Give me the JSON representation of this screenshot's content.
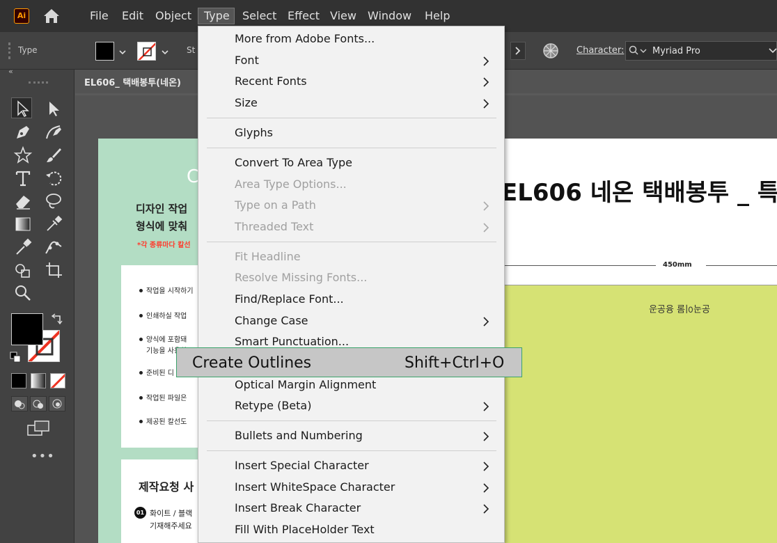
{
  "app": {
    "logo": "Ai",
    "home_icon": "home-icon"
  },
  "menubar": [
    "File",
    "Edit",
    "Object",
    "Type",
    "Select",
    "Effect",
    "View",
    "Window",
    "Help"
  ],
  "control": {
    "label": "Type",
    "stroke_label": "St",
    "character_label": "Character:",
    "font_name": "Myriad Pro"
  },
  "document": {
    "title": "EL606_ 택배봉투(네온)"
  },
  "artboard_left": {
    "big_letter": "C",
    "heading1": "디자인 작업",
    "heading2": "형식에 맞춰",
    "warning": "*각 종류마다 칼선",
    "bullets": [
      "작업을 시작하기",
      "인쇄하실 작업",
      "양식에 포함돼",
      "기능을 사용하",
      "준비된 디",
      "작업된 파일은",
      "제공된 칼선도"
    ],
    "box2_title": "제작요청 사",
    "box2_num": "01",
    "box2_line1": "화이트 / 블랙",
    "box2_line2": "기재해주세요"
  },
  "artboard_right": {
    "title": "EL606 네온 택배봉투 _ 특",
    "dimension": "450mm",
    "bag_text": "운곡이물 용운공"
  },
  "type_menu": {
    "items": [
      {
        "label": "More from Adobe Fonts...",
        "enabled": true,
        "submenu": false
      },
      {
        "label": "Font",
        "enabled": true,
        "submenu": true
      },
      {
        "label": "Recent Fonts",
        "enabled": true,
        "submenu": true
      },
      {
        "label": "Size",
        "enabled": true,
        "submenu": true
      },
      {
        "label": "Glyphs",
        "enabled": true,
        "submenu": false
      },
      {
        "label": "Convert To Area Type",
        "enabled": true,
        "submenu": false
      },
      {
        "label": "Area Type Options...",
        "enabled": false,
        "submenu": false
      },
      {
        "label": "Type on a Path",
        "enabled": false,
        "submenu": true
      },
      {
        "label": "Threaded Text",
        "enabled": false,
        "submenu": true
      },
      {
        "label": "Fit Headline",
        "enabled": false,
        "submenu": false
      },
      {
        "label": "Resolve Missing Fonts...",
        "enabled": false,
        "submenu": false
      },
      {
        "label": "Find/Replace Font...",
        "enabled": true,
        "submenu": false
      },
      {
        "label": "Change Case",
        "enabled": true,
        "submenu": true
      },
      {
        "label": "Smart Punctuation...",
        "enabled": true,
        "submenu": false
      },
      {
        "label": "Create Outlines",
        "enabled": true,
        "submenu": false,
        "shortcut": "Shift+Ctrl+O",
        "highlighted": true
      },
      {
        "label": "Optical Margin Alignment",
        "enabled": true,
        "submenu": false
      },
      {
        "label": "Retype (Beta)",
        "enabled": true,
        "submenu": true
      },
      {
        "label": "Bullets and Numbering",
        "enabled": true,
        "submenu": true
      },
      {
        "label": "Insert Special Character",
        "enabled": true,
        "submenu": true
      },
      {
        "label": "Insert WhiteSpace Character",
        "enabled": true,
        "submenu": true
      },
      {
        "label": "Insert Break Character",
        "enabled": true,
        "submenu": true
      },
      {
        "label": "Fill With PlaceHolder Text",
        "enabled": true,
        "submenu": false
      }
    ]
  },
  "colors": {
    "menu_highlight_border": "#3aa36b",
    "artboard_left_bg": "#b3ddc4",
    "bag_color": "#d6e274",
    "warning": "#ff3c2e"
  }
}
